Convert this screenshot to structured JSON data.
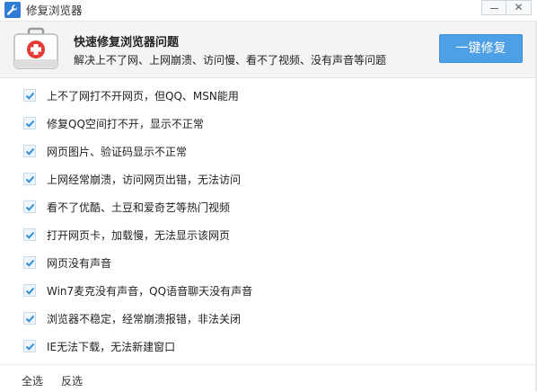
{
  "window": {
    "title": "修复浏览器",
    "minimize_label": "",
    "close_label": "✕"
  },
  "header": {
    "title": "快速修复浏览器问题",
    "subtitle": "解决上不了网、上网崩溃、访问慢、看不了视频、没有声音等问题",
    "fix_button": "一键修复",
    "icon": "first-aid-kit-icon"
  },
  "items": [
    {
      "label": "上不了网打不开网页，但QQ、MSN能用",
      "checked": true
    },
    {
      "label": "修复QQ空间打不开，显示不正常",
      "checked": true
    },
    {
      "label": "网页图片、验证码显示不正常",
      "checked": true
    },
    {
      "label": "上网经常崩溃，访问网页出错，无法访问",
      "checked": true
    },
    {
      "label": "看不了优酷、土豆和爱奇艺等热门视频",
      "checked": true
    },
    {
      "label": "打开网页卡，加载慢，无法显示该网页",
      "checked": true
    },
    {
      "label": "网页没有声音",
      "checked": true
    },
    {
      "label": "Win7麦克没有声音，QQ语音聊天没有声音",
      "checked": true
    },
    {
      "label": "浏览器不稳定，经常崩溃报错，非法关闭",
      "checked": true
    },
    {
      "label": "IE无法下载，无法新建窗口",
      "checked": true
    }
  ],
  "footer": {
    "select_all": "全选",
    "invert": "反选"
  },
  "colors": {
    "accent": "#4d9fe6",
    "check": "#2f8fdc",
    "header_bg": "#f4f4f4",
    "kit_red": "#e53935"
  }
}
